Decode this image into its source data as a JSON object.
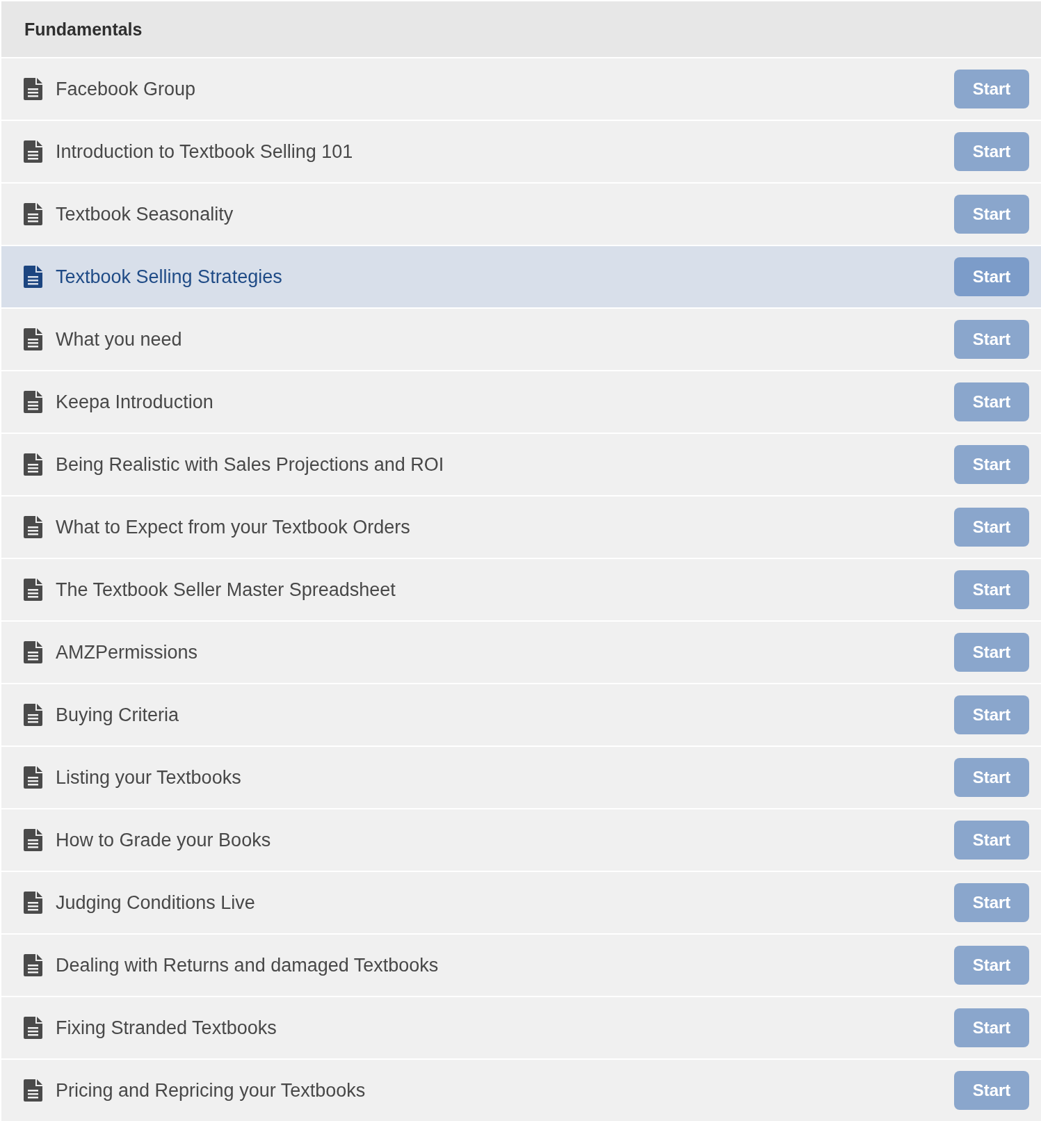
{
  "section": {
    "title": "Fundamentals"
  },
  "lessons": [
    {
      "title": "Facebook Group",
      "button": "Start",
      "selected": false
    },
    {
      "title": "Introduction to Textbook Selling 101",
      "button": "Start",
      "selected": false
    },
    {
      "title": "Textbook Seasonality",
      "button": "Start",
      "selected": false
    },
    {
      "title": "Textbook Selling Strategies",
      "button": "Start",
      "selected": true
    },
    {
      "title": "What you need",
      "button": "Start",
      "selected": false
    },
    {
      "title": "Keepa Introduction",
      "button": "Start",
      "selected": false
    },
    {
      "title": "Being Realistic with Sales Projections and ROI",
      "button": "Start",
      "selected": false
    },
    {
      "title": "What to Expect from your Textbook Orders",
      "button": "Start",
      "selected": false
    },
    {
      "title": "The Textbook Seller Master Spreadsheet",
      "button": "Start",
      "selected": false
    },
    {
      "title": "AMZPermissions",
      "button": "Start",
      "selected": false
    },
    {
      "title": "Buying Criteria",
      "button": "Start",
      "selected": false
    },
    {
      "title": "Listing your Textbooks",
      "button": "Start",
      "selected": false
    },
    {
      "title": "How to Grade your Books",
      "button": "Start",
      "selected": false
    },
    {
      "title": "Judging Conditions Live",
      "button": "Start",
      "selected": false
    },
    {
      "title": "Dealing with Returns and damaged Textbooks",
      "button": "Start",
      "selected": false
    },
    {
      "title": "Fixing Stranded Textbooks",
      "button": "Start",
      "selected": false
    },
    {
      "title": "Pricing and Repricing your Textbooks",
      "button": "Start",
      "selected": false
    }
  ]
}
